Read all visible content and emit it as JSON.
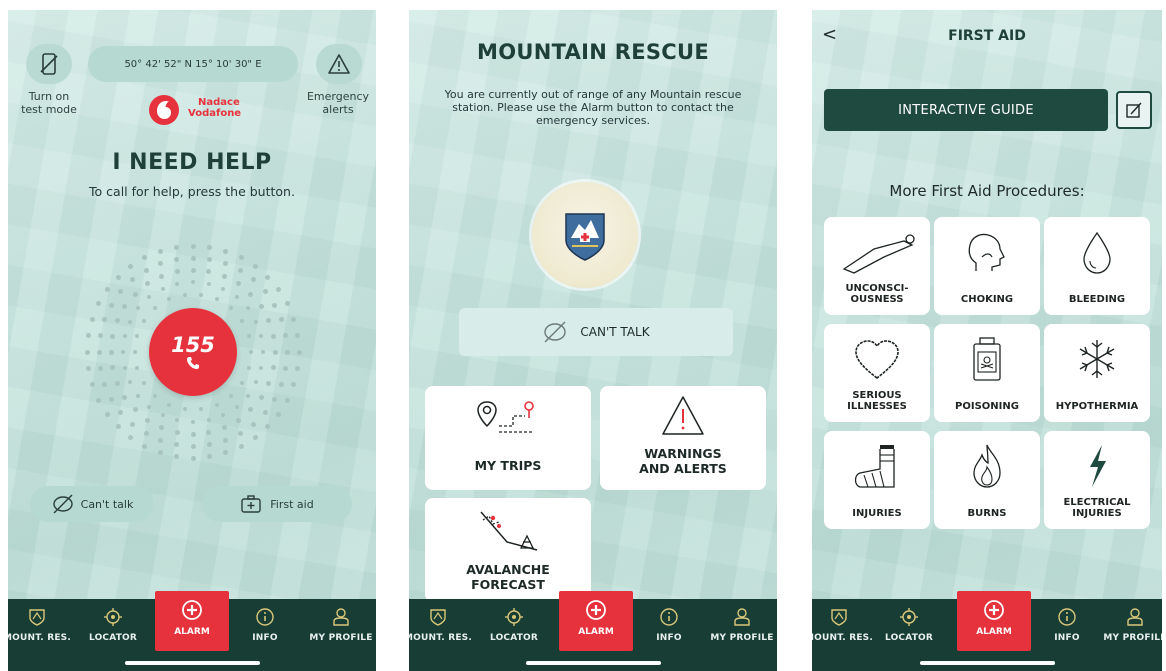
{
  "screen1": {
    "test_mode_label_line1": "Turn on",
    "test_mode_label_line2": "test mode",
    "gps_text": "50° 42' 52\" N 15° 10' 30\" E",
    "emergency_label_line1": "Emergency",
    "emergency_label_line2": "alerts",
    "sponsor_line1": "Nadace",
    "sponsor_line2": "Vodafone",
    "title": "I NEED HELP",
    "subtitle": "To call for help, press the button.",
    "call_number": "155",
    "cant_talk_label": "Can't talk",
    "first_aid_label": "First aid"
  },
  "screen2": {
    "title": "MOUNTAIN RESCUE",
    "message": "You are currently out of range of any Mountain rescue station. Please use the Alarm button to contact the emergency services.",
    "cant_talk_label": "CAN'T TALK",
    "tiles": {
      "my_trips": "MY TRIPS",
      "warnings_line1": "WARNINGS",
      "warnings_line2": "AND ALERTS",
      "avalanche_line1": "AVALANCHE",
      "avalanche_line2": "FORECAST"
    }
  },
  "screen3": {
    "back_glyph": "<",
    "title": "FIRST AID",
    "interactive_guide_label": "INTERACTIVE GUIDE",
    "section_heading": "More First Aid Procedures:",
    "procedures": [
      {
        "line1": "UNCONSCI-",
        "line2": "OUSNESS"
      },
      {
        "line1": "CHOKING",
        "line2": ""
      },
      {
        "line1": "BLEEDING",
        "line2": ""
      },
      {
        "line1": "SERIOUS",
        "line2": "ILLNESSES"
      },
      {
        "line1": "POISONING",
        "line2": ""
      },
      {
        "line1": "HYPOTHERMIA",
        "line2": ""
      },
      {
        "line1": "INJURIES",
        "line2": ""
      },
      {
        "line1": "BURNS",
        "line2": ""
      },
      {
        "line1": "ELECTRICAL",
        "line2": "INJURIES"
      }
    ]
  },
  "nav": {
    "mount_res": "MOUNT. RES.",
    "locator": "LOCATOR",
    "alarm": "ALARM",
    "info": "INFO",
    "my_profile": "MY PROFILE"
  },
  "colors": {
    "accent_red": "#e6323c",
    "nav_dark_green": "#183d35",
    "title_green": "#1e4038",
    "background_mint": "#c7e4de"
  },
  "icons": [
    "phone-icon",
    "warning-triangle-icon",
    "vodafone-logo",
    "no-speech-icon",
    "first-aid-kit-icon",
    "mountain-rescue-badge",
    "map-pin-route-icon",
    "avalanche-icon",
    "pencil-edit-icon",
    "shield-icon",
    "crosshair-icon",
    "plus-circle-icon",
    "info-icon",
    "user-icon"
  ]
}
